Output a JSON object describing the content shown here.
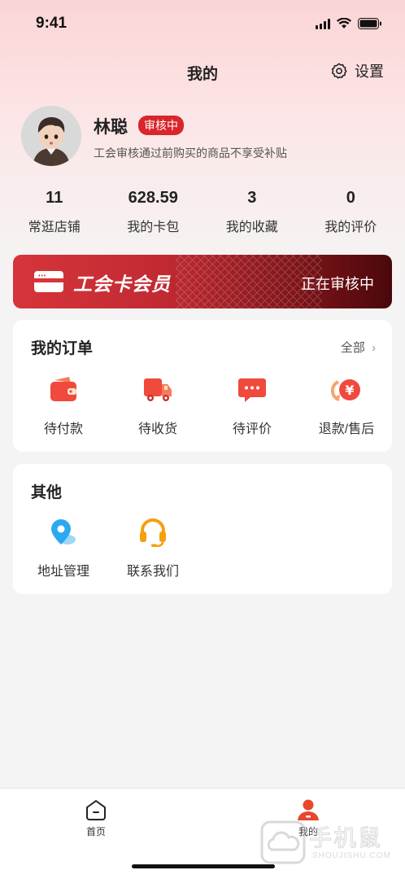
{
  "status_bar": {
    "time": "9:41"
  },
  "nav": {
    "title": "我的",
    "settings_label": "设置"
  },
  "profile": {
    "name": "林聪",
    "badge": "审核中",
    "note": "工会审核通过前购买的商品不享受补贴"
  },
  "stats": [
    {
      "value": "11",
      "label": "常逛店铺"
    },
    {
      "value": "628.59",
      "label": "我的卡包"
    },
    {
      "value": "3",
      "label": "我的收藏"
    },
    {
      "value": "0",
      "label": "我的评价"
    }
  ],
  "member_card": {
    "title": "工会卡会员",
    "status": "正在审核中"
  },
  "orders": {
    "title": "我的订单",
    "more": "全部",
    "items": [
      {
        "label": "待付款",
        "icon": "wallet-icon"
      },
      {
        "label": "待收货",
        "icon": "truck-icon"
      },
      {
        "label": "待评价",
        "icon": "comment-icon"
      },
      {
        "label": "退款/售后",
        "icon": "refund-icon"
      }
    ]
  },
  "others": {
    "title": "其他",
    "items": [
      {
        "label": "地址管理",
        "icon": "location-icon"
      },
      {
        "label": "联系我们",
        "icon": "headset-icon"
      }
    ]
  },
  "tabbar": {
    "items": [
      {
        "label": "首页",
        "icon": "home-icon"
      },
      {
        "label": "我的",
        "icon": "user-icon"
      }
    ]
  },
  "watermark": {
    "text": "手机鼠",
    "sub": "SHOUJISHU.COM"
  },
  "colors": {
    "accent": "#d9252b",
    "order_icon": "#f04a3d",
    "active_tab": "#e8462d"
  }
}
